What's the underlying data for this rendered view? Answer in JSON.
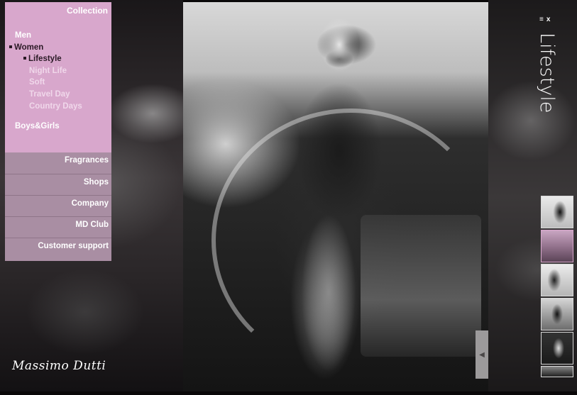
{
  "menu": {
    "collection_label": "Collection",
    "items": [
      {
        "label": "Men"
      },
      {
        "label": "Women"
      },
      {
        "label": "Lifestyle"
      },
      {
        "label": "Night Life"
      },
      {
        "label": "Soft"
      },
      {
        "label": "Travel Day"
      },
      {
        "label": "Country Days"
      },
      {
        "label": "Boys&Girls"
      }
    ],
    "secondary": [
      {
        "label": "Fragrances"
      },
      {
        "label": "Shops"
      },
      {
        "label": "Company"
      },
      {
        "label": "MD Club"
      },
      {
        "label": "Customer support"
      }
    ]
  },
  "brand": {
    "logo_text": "Massimo Dutti"
  },
  "section": {
    "title": "Lifestyle",
    "close_label": "x"
  },
  "colors": {
    "menu_top": "#d8a7cc",
    "menu_bottom": "#a98ea3",
    "active_text": "#2b1a26",
    "submenu_text": "#f0d7ea"
  },
  "icons": {
    "menu_toggle": "list-icon",
    "close": "close-icon",
    "prev_arrow": "arrow-left-icon"
  },
  "thumbnails": [
    {
      "name": "thumb-1"
    },
    {
      "name": "thumb-2",
      "active": true
    },
    {
      "name": "thumb-3"
    },
    {
      "name": "thumb-4"
    },
    {
      "name": "thumb-5"
    },
    {
      "name": "thumb-6"
    }
  ]
}
